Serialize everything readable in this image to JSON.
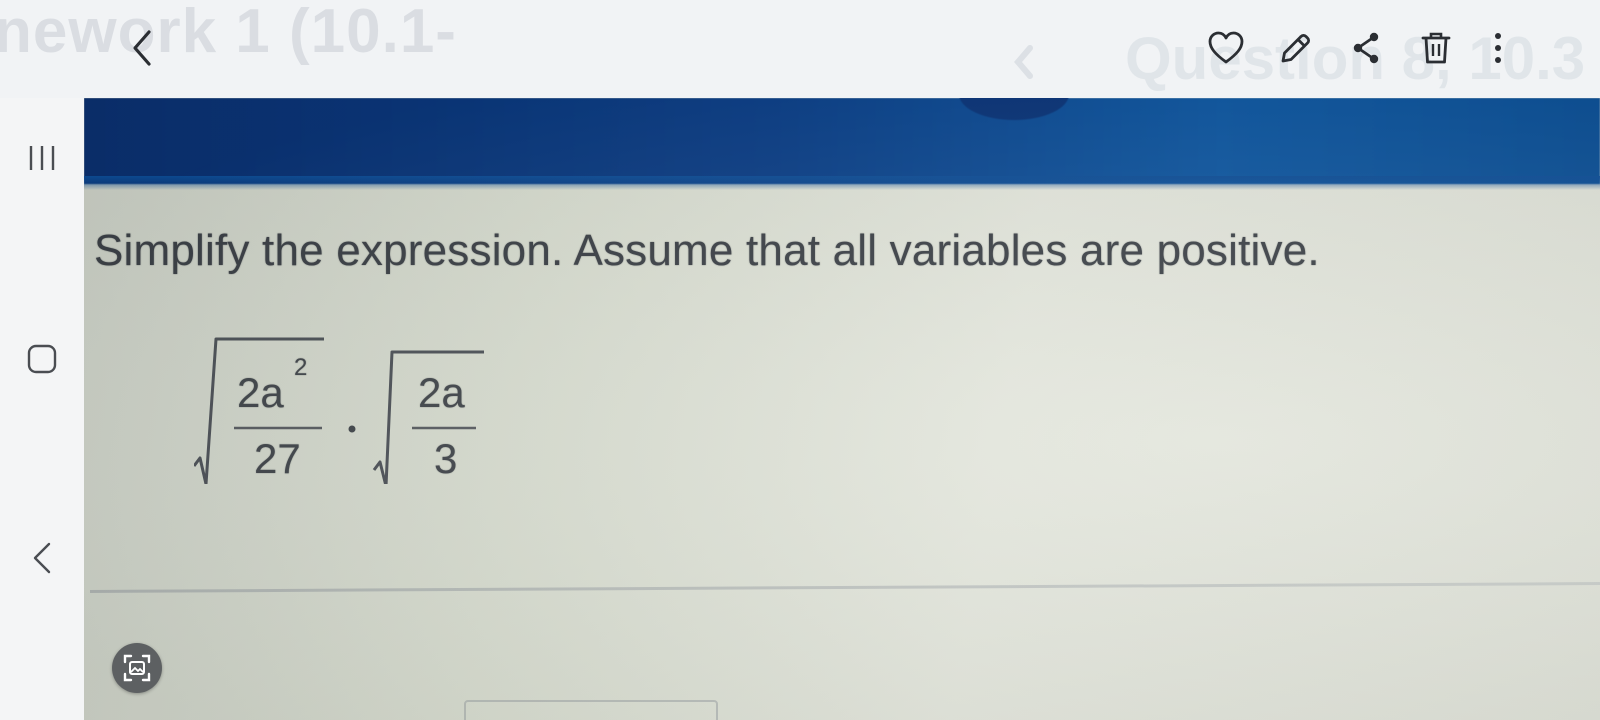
{
  "toolbar": {
    "ghost_title_left": "nework 1 (10.1-",
    "ghost_title_right": "Question 8, 10.3",
    "back_icon": "chevron-left-icon",
    "actions": [
      {
        "name": "favorite",
        "icon": "heart-outline-icon"
      },
      {
        "name": "edit",
        "icon": "pencil-icon"
      },
      {
        "name": "share",
        "icon": "share-nodes-icon"
      },
      {
        "name": "delete",
        "icon": "trash-icon"
      },
      {
        "name": "more",
        "icon": "more-vertical-icon"
      }
    ],
    "icon_color": "#2b2e33"
  },
  "navbar": {
    "items": [
      {
        "name": "recent-apps",
        "icon": "recent-apps-icon"
      },
      {
        "name": "home",
        "icon": "home-icon"
      },
      {
        "name": "back",
        "icon": "back-icon"
      }
    ]
  },
  "photo": {
    "header_color": "#0b3e86",
    "question_text": "Simplify the expression. Assume that all variables are positive.",
    "expression": {
      "term1": {
        "numerator": "2a",
        "exponent": "2",
        "denominator": "27"
      },
      "operator": "·",
      "term2": {
        "numerator": "2a",
        "denominator": "3"
      }
    }
  },
  "capture_button": {
    "icon": "image-capture-icon"
  }
}
